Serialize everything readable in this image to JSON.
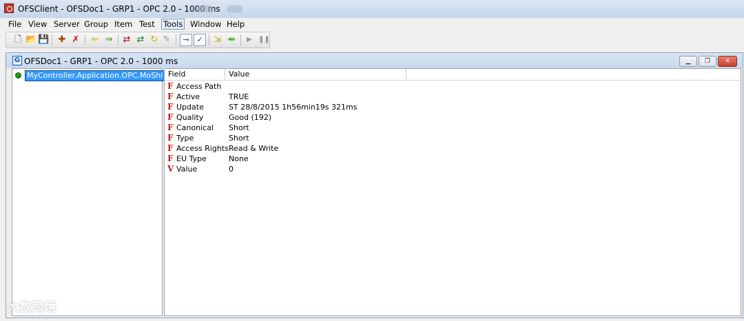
{
  "window": {
    "title": "OFSClient - OFSDoc1 - GRP1 - OPC 2.0 - 1000 ms"
  },
  "menu": {
    "items": [
      "File",
      "View",
      "Server",
      "Group",
      "Item",
      "Test",
      "Tools",
      "Window",
      "Help"
    ],
    "active": "Tools"
  },
  "toolbar": {
    "icons": [
      "new-file-icon",
      "open-folder-icon",
      "save-icon",
      "add-item-icon",
      "delete-item-icon",
      "arrow-left-icon",
      "arrow-right-icon",
      "swap-icon",
      "swap-alt-icon",
      "refresh-icon",
      "write-icon",
      "read-icon",
      "check-icon",
      "import-icon",
      "export-icon",
      "play-icon",
      "pause-icon"
    ]
  },
  "document": {
    "title": "OFSDoc1 - GRP1 - OPC 2.0 - 1000 ms",
    "icon_letter": "G"
  },
  "tree": {
    "node_label": "MyController.Application.OPC.MoShi"
  },
  "table": {
    "columns": [
      "Field",
      "Value"
    ],
    "rows": [
      {
        "icon": "F",
        "field": "Access Path",
        "value": ""
      },
      {
        "icon": "F",
        "field": "Active",
        "value": "TRUE"
      },
      {
        "icon": "F",
        "field": "Update",
        "value": "ST 28/8/2015 1h56min19s 321ms"
      },
      {
        "icon": "F",
        "field": "Quality",
        "value": "Good (192)"
      },
      {
        "icon": "F",
        "field": "Canonical",
        "value": "Short"
      },
      {
        "icon": "F",
        "field": "Type",
        "value": "Short"
      },
      {
        "icon": "F",
        "field": "Access Rights",
        "value": "Read & Write"
      },
      {
        "icon": "F",
        "field": "EU Type",
        "value": "None"
      },
      {
        "icon": "V",
        "field": "Value",
        "value": "0"
      }
    ]
  },
  "watermark": {
    "text": "大数跨境"
  },
  "colors": {
    "selection": "#3399ff",
    "field_icon": "#c21d1d",
    "status_ok": "#1a9f1a"
  }
}
